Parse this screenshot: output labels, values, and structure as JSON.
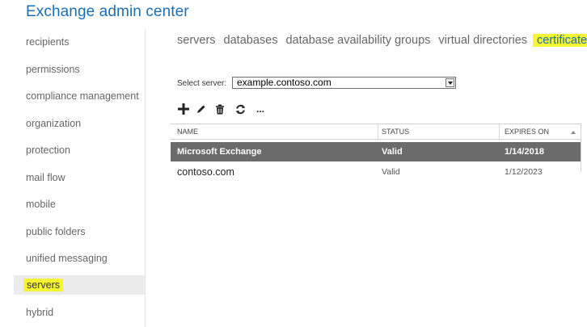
{
  "app": {
    "title": "Exchange admin center"
  },
  "sidebar": {
    "items": [
      {
        "label": "recipients"
      },
      {
        "label": "permissions"
      },
      {
        "label": "compliance management"
      },
      {
        "label": "organization"
      },
      {
        "label": "protection"
      },
      {
        "label": "mail flow"
      },
      {
        "label": "mobile"
      },
      {
        "label": "public folders"
      },
      {
        "label": "unified messaging"
      },
      {
        "label": "servers",
        "selected": true
      },
      {
        "label": "hybrid"
      }
    ]
  },
  "tabs": [
    {
      "label": "servers"
    },
    {
      "label": "databases"
    },
    {
      "label": "database availability groups"
    },
    {
      "label": "virtual directories"
    },
    {
      "label": "certificates",
      "active": true
    }
  ],
  "server_select": {
    "label": "Select server:",
    "value": "example.contoso.com"
  },
  "toolbar": {
    "icons": [
      "add-icon",
      "edit-icon",
      "delete-icon",
      "refresh-icon",
      "more-icon"
    ],
    "more_label": "..."
  },
  "table": {
    "columns": [
      "NAME",
      "STATUS",
      "EXPIRES ON"
    ],
    "rows": [
      {
        "name": "Microsoft Exchange",
        "status": "Valid",
        "expires": "1/14/2018",
        "selected": true
      },
      {
        "name": "contoso.com",
        "status": "Valid",
        "expires": "1/12/2023",
        "selected": false
      }
    ]
  },
  "colors": {
    "accent": "#1a6fb3",
    "highlight": "#f5f531",
    "selected_row": "#6b6b6b"
  }
}
